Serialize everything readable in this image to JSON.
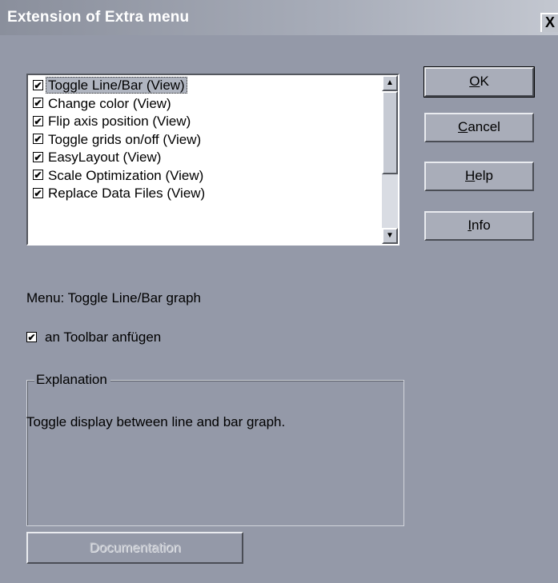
{
  "window": {
    "title": "Extension of Extra menu",
    "close_glyph": "X"
  },
  "list": {
    "items": [
      {
        "label": "Toggle Line/Bar (View)",
        "checked": true,
        "selected": true
      },
      {
        "label": "Change color (View)",
        "checked": true,
        "selected": false
      },
      {
        "label": "Flip axis position (View)",
        "checked": true,
        "selected": false
      },
      {
        "label": "Toggle grids on/off (View)",
        "checked": true,
        "selected": false
      },
      {
        "label": "EasyLayout (View)",
        "checked": true,
        "selected": false
      },
      {
        "label": "Scale Optimization (View)",
        "checked": true,
        "selected": false
      },
      {
        "label": "Replace Data Files (View)",
        "checked": true,
        "selected": false
      }
    ],
    "scroll_up_icon": "arrow-up",
    "scroll_down_icon": "arrow-down"
  },
  "buttons": {
    "ok": {
      "mnemonic": "O",
      "rest": "K"
    },
    "cancel": {
      "mnemonic": "C",
      "rest": "ancel"
    },
    "help": {
      "mnemonic": "H",
      "rest": "elp"
    },
    "info": {
      "mnemonic": "I",
      "rest": "nfo"
    }
  },
  "menu_label": "Menu: Toggle Line/Bar graph",
  "toolbar_option": {
    "label": "an Toolbar anfügen",
    "checked": true
  },
  "explanation": {
    "group_title": "Explanation",
    "text": "Toggle display between line and bar graph."
  },
  "documentation_button": {
    "label": "Documentation",
    "enabled": false
  },
  "colors": {
    "dialog_background": "#9499a8",
    "list_background": "#ffffff",
    "title_text": "#ffffff"
  }
}
